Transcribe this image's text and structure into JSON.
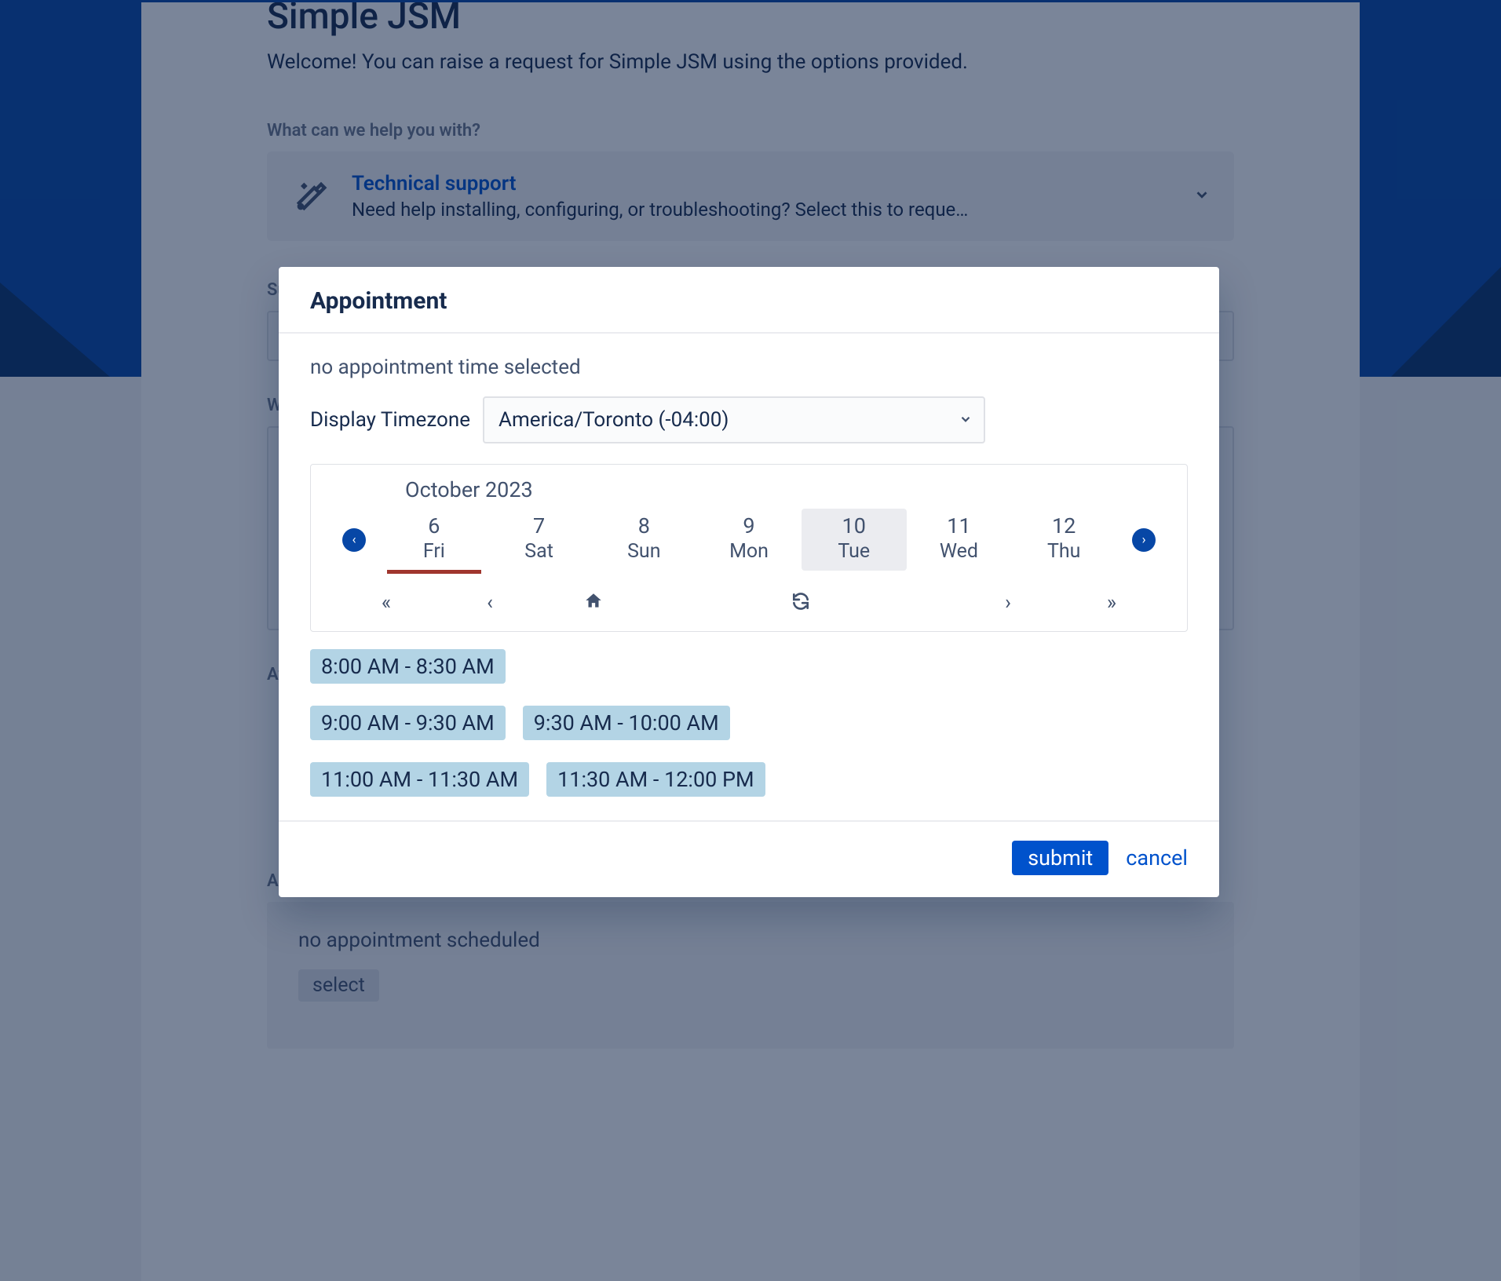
{
  "page": {
    "title": "Simple JSM",
    "welcome": "Welcome! You can raise a request for Simple JSM using the options provided.",
    "help_label": "What can we help you with?",
    "request_type": {
      "title": "Technical support",
      "desc": "Need help installing, configuring, or troubleshooting? Select this to reque…"
    },
    "field_summary_label_partial": "Su",
    "field_detail_label_partial": "W",
    "field_attach_label_partial": "At",
    "appointment_label": "Appointment",
    "appt_status": "no appointment scheduled",
    "select_label": "select"
  },
  "modal": {
    "title": "Appointment",
    "no_selection": "no appointment time selected",
    "tz_label": "Display Timezone",
    "tz_value": "America/Toronto (-04:00)",
    "cal": {
      "month_label": "October 2023",
      "days": [
        {
          "num": "6",
          "name": "Fri",
          "today": true,
          "selected": false
        },
        {
          "num": "7",
          "name": "Sat",
          "today": false,
          "selected": false
        },
        {
          "num": "8",
          "name": "Sun",
          "today": false,
          "selected": false
        },
        {
          "num": "9",
          "name": "Mon",
          "today": false,
          "selected": false
        },
        {
          "num": "10",
          "name": "Tue",
          "today": false,
          "selected": true
        },
        {
          "num": "11",
          "name": "Wed",
          "today": false,
          "selected": false
        },
        {
          "num": "12",
          "name": "Thu",
          "today": false,
          "selected": false
        }
      ]
    },
    "slots": [
      "8:00 AM - 8:30 AM",
      "9:00 AM - 9:30 AM",
      "9:30 AM - 10:00 AM",
      "11:00 AM - 11:30 AM",
      "11:30 AM - 12:00 PM"
    ],
    "submit": "submit",
    "cancel": "cancel"
  }
}
